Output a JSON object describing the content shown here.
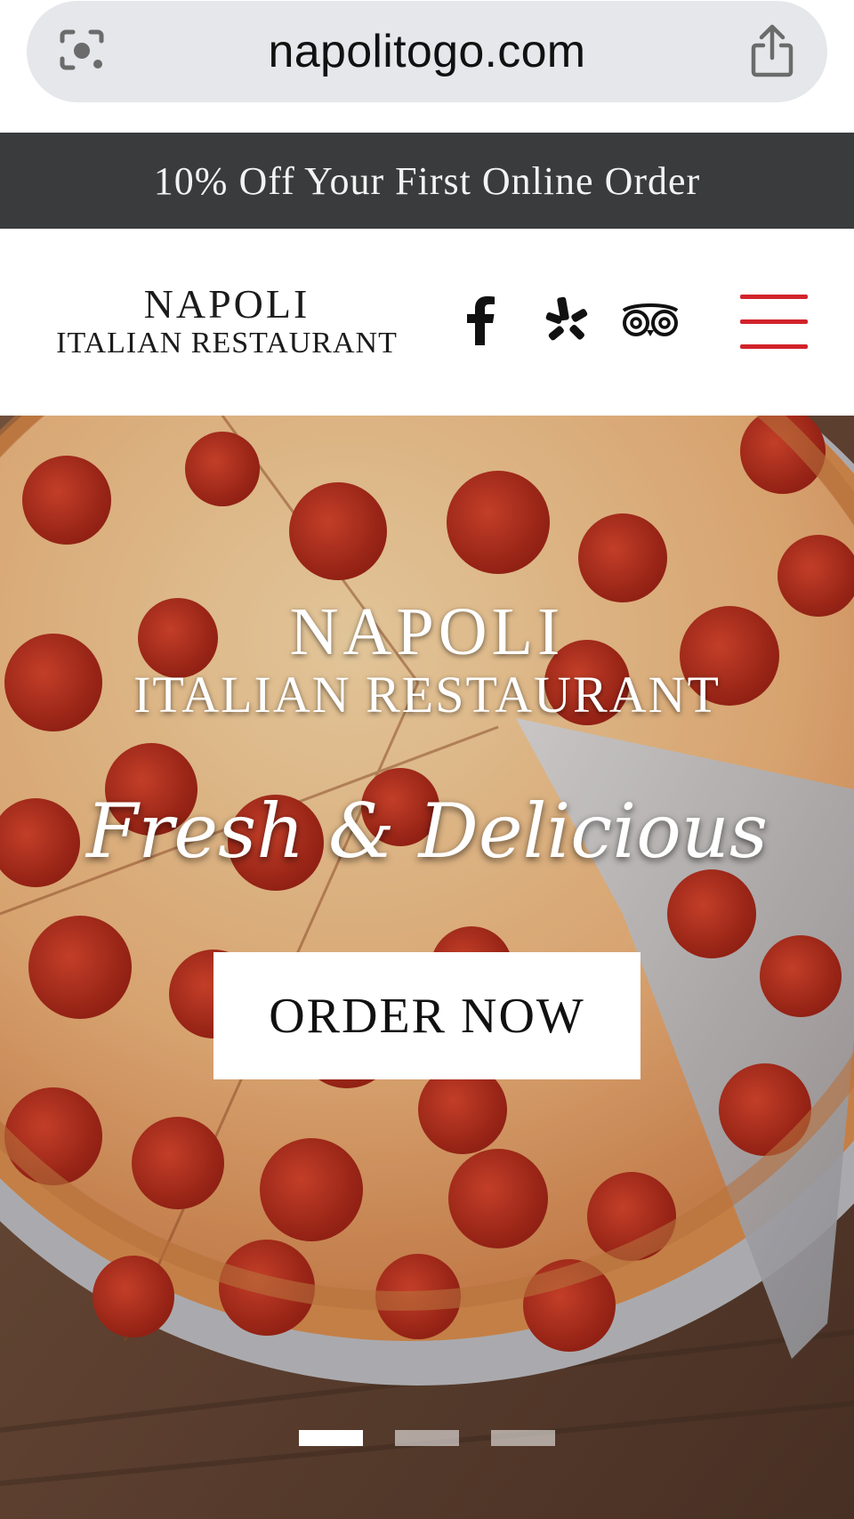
{
  "browser": {
    "url": "napolitogo.com",
    "lens_icon": "camera-lens-icon",
    "share_icon": "share-icon"
  },
  "promo": {
    "text": "10% Off Your First Online Order"
  },
  "header": {
    "logo_line1": "NAPOLI",
    "logo_line2": "ITALIAN RESTAURANT",
    "social": [
      {
        "name": "facebook",
        "icon": "facebook-icon"
      },
      {
        "name": "yelp",
        "icon": "yelp-icon"
      },
      {
        "name": "tripadvisor",
        "icon": "tripadvisor-icon"
      }
    ],
    "menu_icon": "hamburger-menu-icon",
    "menu_color": "#d2232a"
  },
  "hero": {
    "title_line1": "NAPOLI",
    "title_line2": "ITALIAN RESTAURANT",
    "tagline": "Fresh & Delicious",
    "cta_label": "ORDER NOW",
    "slides_total": 3,
    "active_slide": 1
  },
  "colors": {
    "promo_bg": "#3a3b3c",
    "accent": "#d2232a"
  }
}
